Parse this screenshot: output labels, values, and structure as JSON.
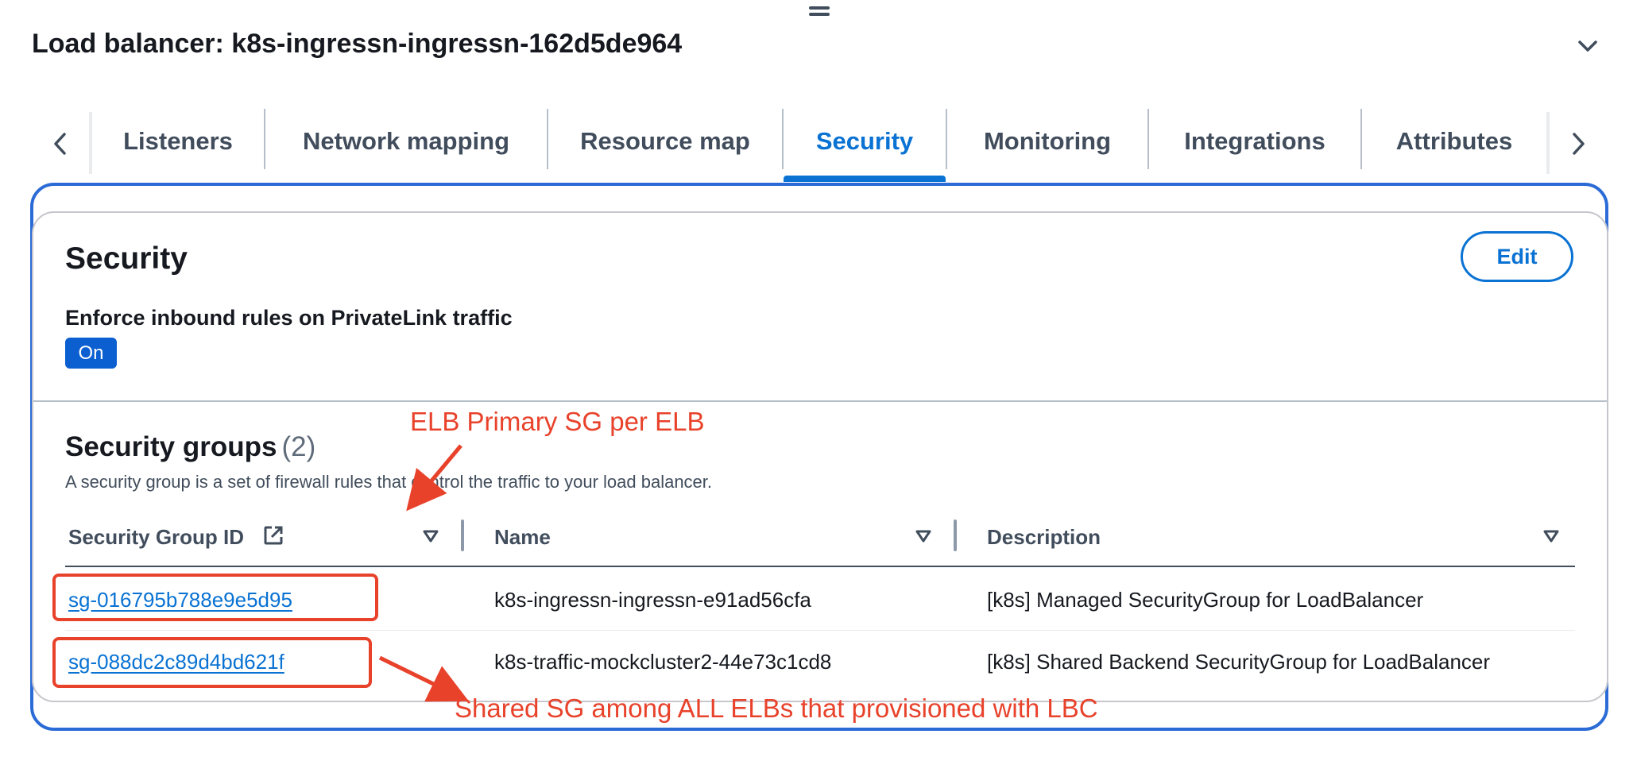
{
  "header": {
    "title": "Load balancer: k8s-ingressn-ingressn-162d5de964"
  },
  "tabs": [
    {
      "label": "Listeners"
    },
    {
      "label": "Network mapping"
    },
    {
      "label": "Resource map"
    },
    {
      "label": "Security",
      "active": true
    },
    {
      "label": "Monitoring"
    },
    {
      "label": "Integrations"
    },
    {
      "label": "Attributes"
    }
  ],
  "security": {
    "title": "Security",
    "edit_label": "Edit",
    "enforce_label": "Enforce inbound rules on PrivateLink traffic",
    "enforce_value": "On"
  },
  "security_groups": {
    "title": "Security groups",
    "count": "(2)",
    "description": "A security group is a set of firewall rules that control the traffic to your load balancer.",
    "columns": [
      {
        "label": "Security Group ID"
      },
      {
        "label": "Name"
      },
      {
        "label": "Description"
      }
    ],
    "rows": [
      {
        "id": "sg-016795b788e9e5d95",
        "name": "k8s-ingressn-ingressn-e91ad56cfa",
        "description": "[k8s] Managed SecurityGroup for LoadBalancer"
      },
      {
        "id": "sg-088dc2c89d4bd621f",
        "name": "k8s-traffic-mockcluster2-44e73c1cd8",
        "description": "[k8s] Shared Backend SecurityGroup for LoadBalancer"
      }
    ]
  },
  "annotations": {
    "primary_sg": "ELB Primary SG per ELB",
    "shared_sg": "Shared SG among ALL ELBs that provisioned with LBC",
    "color": "#e8422b"
  },
  "colors": {
    "accent": "#0972d3",
    "badge": "#0b5fd0",
    "frame": "#2b6bd6"
  },
  "icons": {
    "drag": "drag-handle-icon",
    "collapse": "chevron-down-icon",
    "scroll_left": "chevron-left-icon",
    "scroll_right": "chevron-right-icon",
    "external": "external-link-icon",
    "filter": "caret-down-filter-icon"
  }
}
